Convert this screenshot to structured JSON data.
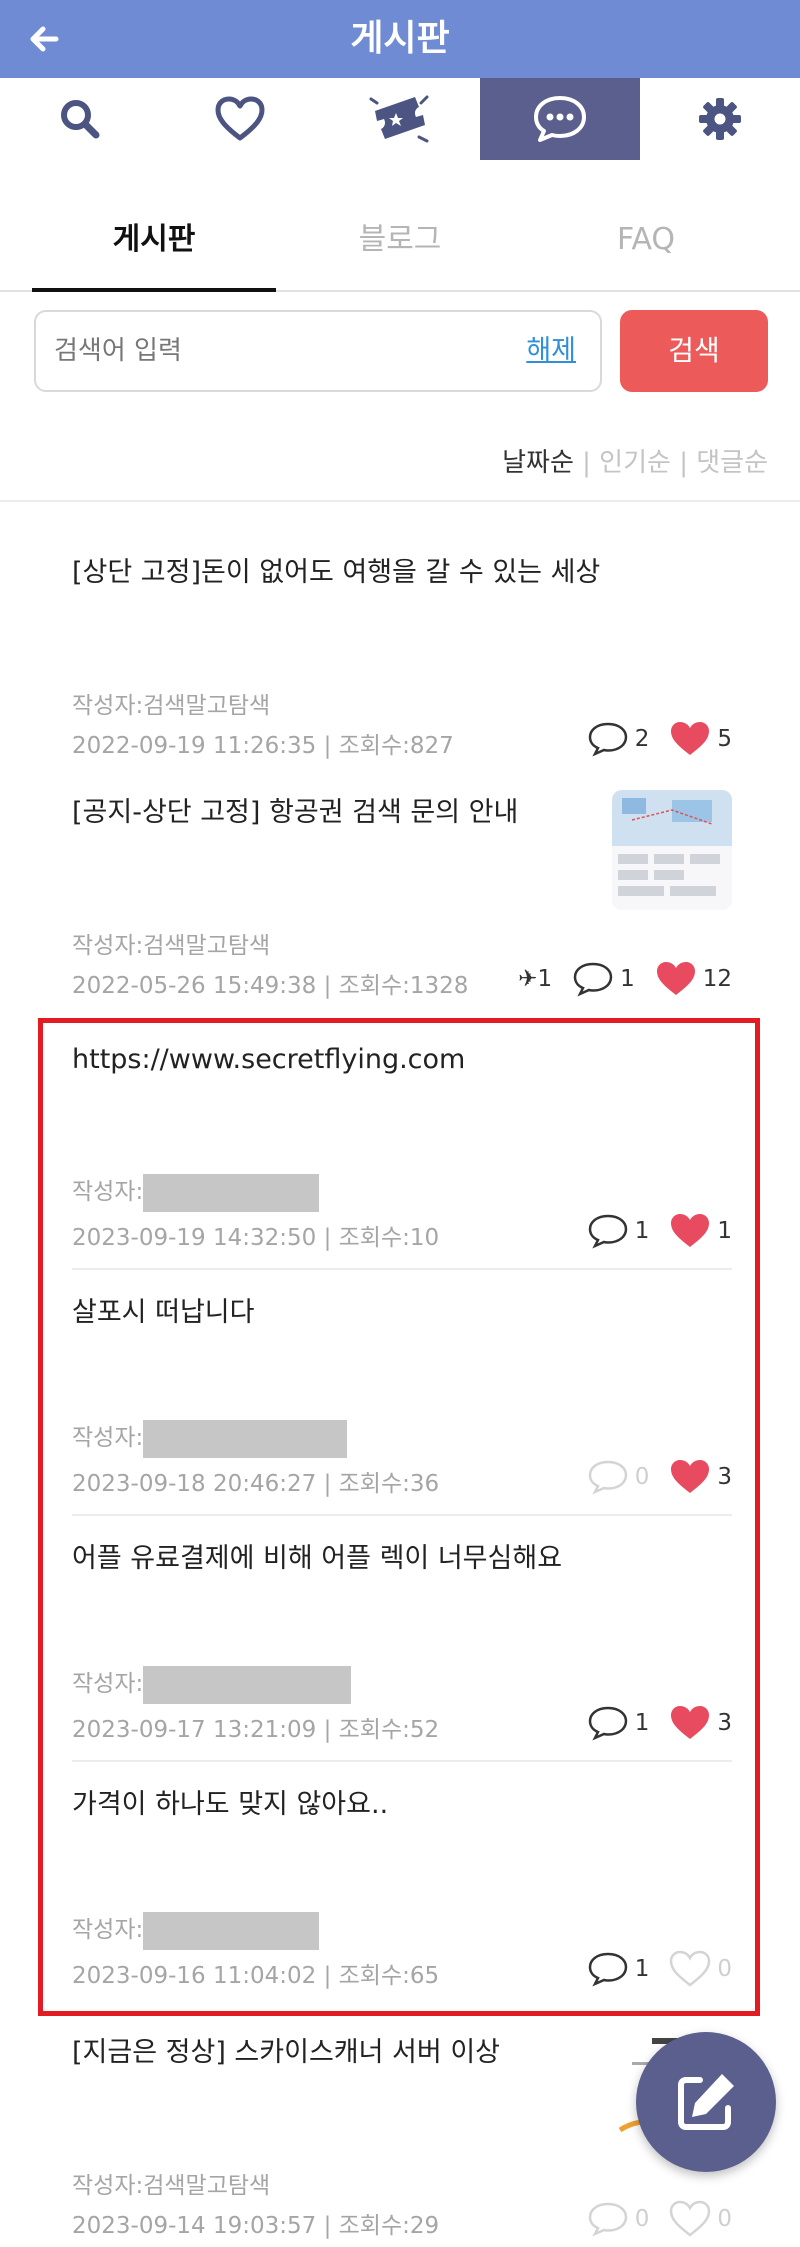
{
  "appbar": {
    "title": "게시판",
    "back_icon": "arrow-left-icon"
  },
  "iconbar": [
    {
      "icon": "search-icon"
    },
    {
      "icon": "heart-icon"
    },
    {
      "icon": "ticket-icon"
    },
    {
      "icon": "chat-icon",
      "active": true
    },
    {
      "icon": "gear-icon"
    }
  ],
  "tabs": [
    {
      "label": "게시판",
      "active": true
    },
    {
      "label": "블로그"
    },
    {
      "label": "FAQ"
    }
  ],
  "search": {
    "placeholder": "검색어 입력",
    "clear_label": "해제",
    "button_label": "검색"
  },
  "sort": {
    "date": "날짜순",
    "popular": "인기순",
    "comments": "댓글순",
    "sep": " | "
  },
  "colors": {
    "header": "#6e8bd3",
    "active_icon_bg": "#5a5f8e",
    "search_button": "#ec5a5a",
    "highlight_border": "#e31b23",
    "heart": "#e84a5f"
  },
  "posts": [
    {
      "title": "[상단 고정]돈이 없어도 여행을 갈 수 있는 세상",
      "author": "작성자:검색말고탐색",
      "meta": "2022-09-19 11:26:35 | 조회수:827",
      "comments": "2",
      "likes": "5"
    },
    {
      "title": "[공지-상단 고정] 항공권 검색 문의 안내",
      "author": "작성자:검색말고탐색",
      "meta": "2022-05-26 15:49:38 | 조회수:1328",
      "flights": "✈1",
      "comments": "1",
      "likes": "12"
    },
    {
      "title": "https://www.secretflying.com",
      "author": "작성자:",
      "meta": "2023-09-19 14:32:50 | 조회수:10",
      "comments": "1",
      "likes": "1"
    },
    {
      "title": "살포시 떠납니다",
      "author": "작성자:",
      "meta": "2023-09-18 20:46:27 | 조회수:36",
      "comments": "0",
      "likes": "3"
    },
    {
      "title": "어플 유료결제에 비해 어플 렉이 너무심해요",
      "author": "작성자:",
      "meta": "2023-09-17 13:21:09 | 조회수:52",
      "comments": "1",
      "likes": "3"
    },
    {
      "title": "가격이 하나도 맞지 않아요..",
      "author": "작성자:",
      "meta": "2023-09-16 11:04:02 | 조회수:65",
      "comments": "1",
      "likes": "0"
    },
    {
      "title": "[지금은 정상] 스카이스캐너 서버 이상",
      "author": "작성자:검색말고탐색",
      "meta": "2023-09-14 19:03:57 | 조회수:29",
      "comments": "0",
      "likes": "0"
    }
  ],
  "fab": {
    "icon": "edit-icon"
  }
}
